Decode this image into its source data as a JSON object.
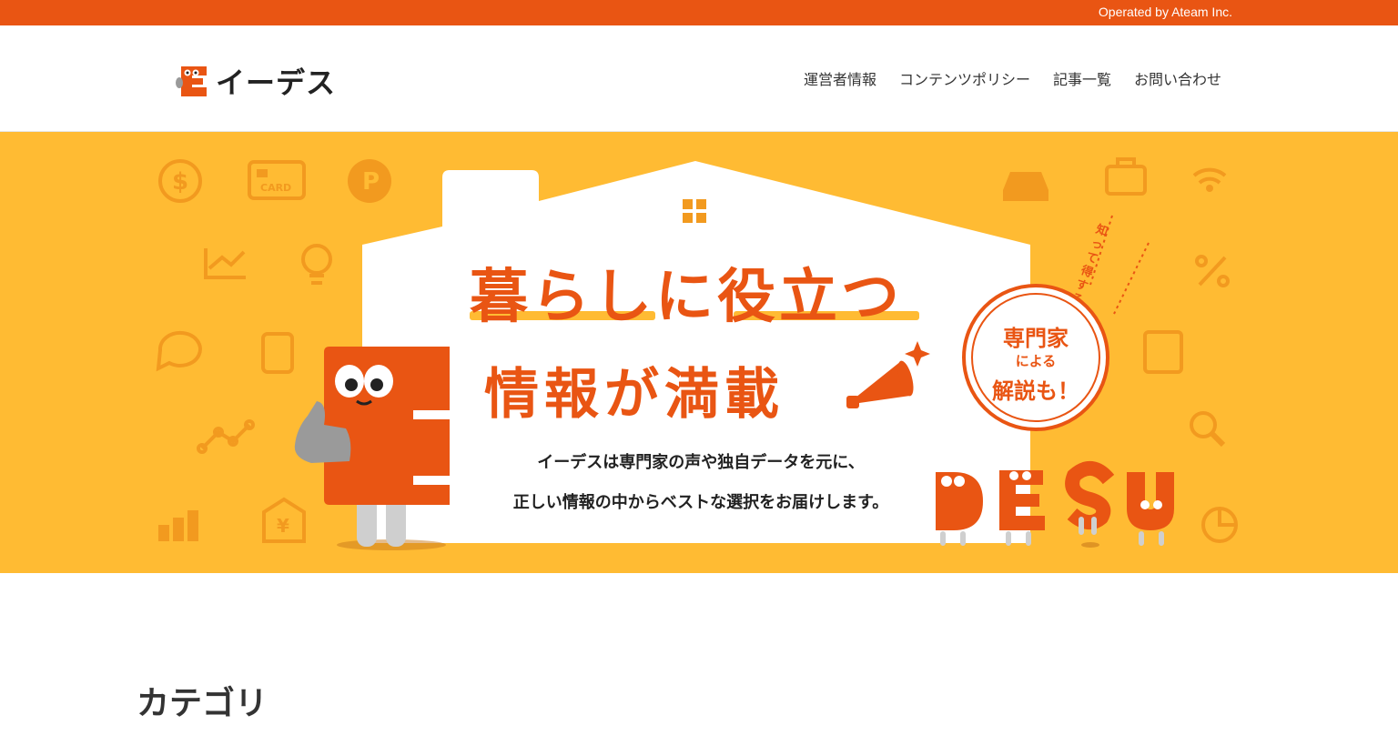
{
  "top_bar": {
    "operator_text": "Operated by Ateam Inc."
  },
  "header": {
    "logo_text": "イーデス",
    "nav": [
      {
        "label": "運営者情報"
      },
      {
        "label": "コンテンツポリシー"
      },
      {
        "label": "記事一覧"
      },
      {
        "label": "お問い合わせ"
      }
    ]
  },
  "hero": {
    "headline_line1": "暮らしに役立つ",
    "headline_line2": "情報が満載",
    "sub_line1": "イーデスは専門家の声や独自データを元に、",
    "sub_line2": "正しい情報の中からベストな選択をお届けします。",
    "badge_line1": "専門家",
    "badge_line2": "による",
    "badge_line3": "解説も！",
    "side_note": "知って得する",
    "card_icon_text": "CARD",
    "desu_letters": "DESU"
  },
  "section": {
    "category_title": "カテゴリ"
  },
  "colors": {
    "brand_orange": "#E95513",
    "hero_yellow": "#FFBB33",
    "icon_orange": "#F29A1F"
  }
}
